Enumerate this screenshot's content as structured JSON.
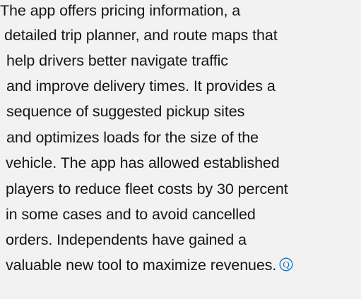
{
  "article": {
    "lines": [
      "The app offers pricing information, a",
      "detailed trip planner, and route maps that",
      "help drivers better navigate traffic",
      "and improve delivery times. It provides a",
      "sequence of suggested pickup sites",
      "and optimizes loads for the size of the",
      "vehicle. The app has allowed established",
      "players to reduce fleet costs by 30 percent",
      "in some cases and to avoid cancelled",
      "orders. Independents have gained a",
      "valuable new tool to maximize revenues."
    ],
    "end_mark": "Q"
  },
  "colors": {
    "text": "#161616",
    "background": "#f2f2f2",
    "end_mark": "#1a6fb0"
  }
}
